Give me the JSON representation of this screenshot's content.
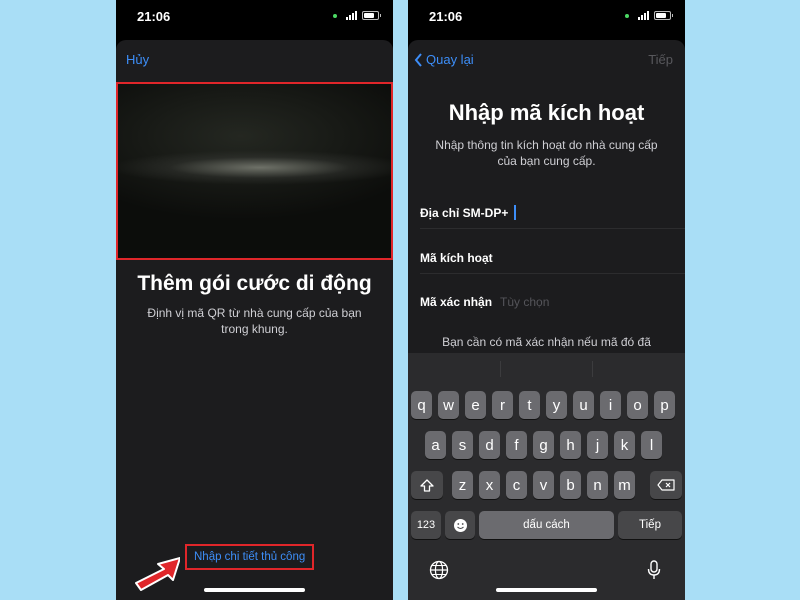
{
  "left": {
    "status": {
      "time": "21:06"
    },
    "nav": {
      "cancel": "Hủy"
    },
    "title": "Thêm gói cước di động",
    "description": "Định vị mã QR từ nhà cung cấp của bạn trong khung.",
    "manual_link": "Nhập chi tiết thủ công"
  },
  "right": {
    "status": {
      "time": "21:06"
    },
    "nav": {
      "back": "Quay lại",
      "next": "Tiếp"
    },
    "title": "Nhập mã kích hoạt",
    "description": "Nhập thông tin kích hoạt do nhà cung cấp của bạn cung cấp.",
    "fields": [
      {
        "label": "Địa chỉ SM-DP+",
        "value": "",
        "placeholder": ""
      },
      {
        "label": "Mã kích hoạt",
        "value": "",
        "placeholder": ""
      },
      {
        "label": "Mã xác nhận",
        "value": "",
        "placeholder": "Tùy chọn"
      }
    ],
    "note": "Bạn cần có mã xác nhận nếu mã đó đã",
    "keyboard": {
      "row1": [
        "q",
        "w",
        "e",
        "r",
        "t",
        "y",
        "u",
        "i",
        "o",
        "p"
      ],
      "row2": [
        "a",
        "s",
        "d",
        "f",
        "g",
        "h",
        "j",
        "k",
        "l"
      ],
      "row3": [
        "z",
        "x",
        "c",
        "v",
        "b",
        "n",
        "m"
      ],
      "numbers": "123",
      "space": "dấu cách",
      "return": "Tiếp",
      "icons": {
        "shift": "shift-icon",
        "delete": "delete-icon",
        "emoji": "emoji-icon",
        "globe": "globe-icon",
        "mic": "mic-icon"
      }
    }
  },
  "colors": {
    "background": "#a9def6",
    "accent": "#3d8ef8",
    "highlight": "#e0262a",
    "sheet": "#1c1c1e"
  }
}
